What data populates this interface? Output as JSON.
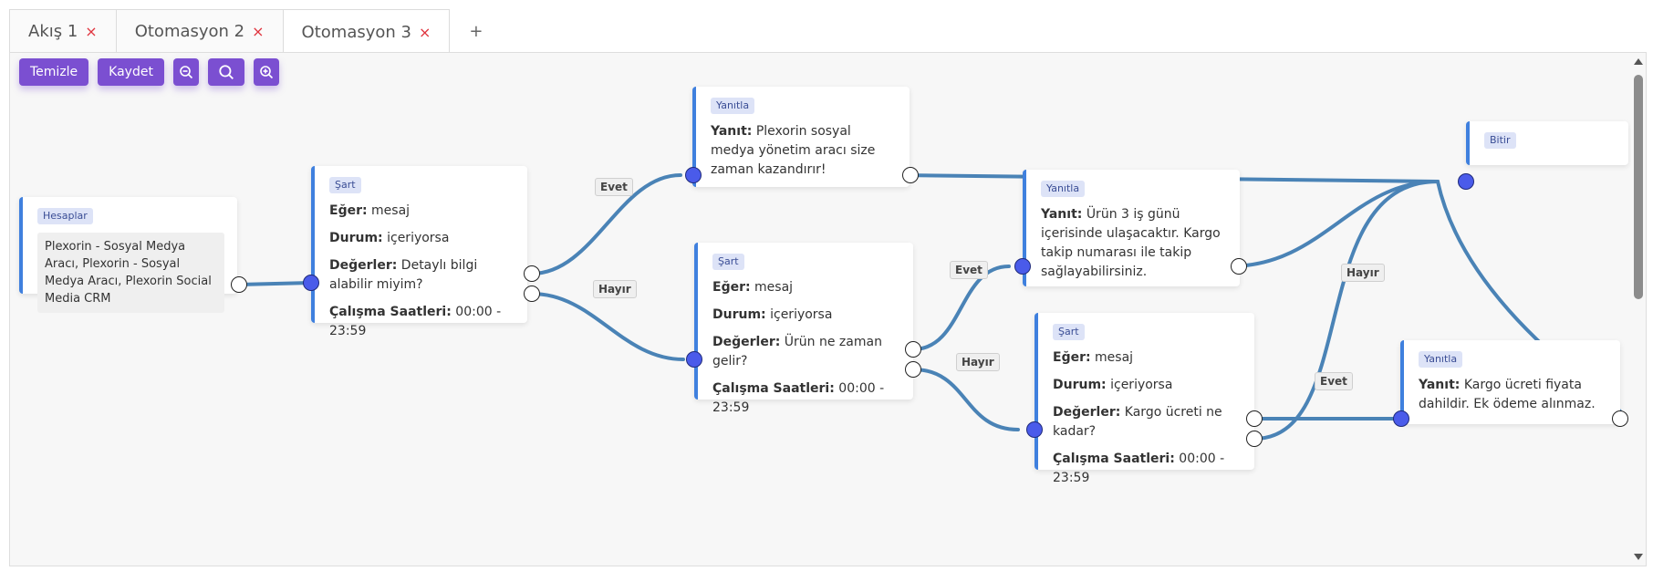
{
  "tabs": [
    {
      "label": "Akış 1",
      "close": "×"
    },
    {
      "label": "Otomasyon 2",
      "close": "×"
    },
    {
      "label": "Otomasyon 3",
      "close": "×"
    }
  ],
  "tab_add": "+",
  "toolbar": {
    "clear": "Temizle",
    "save": "Kaydet"
  },
  "nodes": {
    "accounts": {
      "title": "Hesaplar",
      "text": "Plexorin - Sosyal Medya Aracı, Plexorin - Sosyal Medya Aracı, Plexorin Social Media CRM"
    },
    "cond1": {
      "title": "Şart",
      "if_k": "Eğer:",
      "if_v": "mesaj",
      "st_k": "Durum:",
      "st_v": "içeriyorsa",
      "val_k": "Değerler:",
      "val_v": "Detaylı bilgi alabilir miyim?",
      "hrs_k": "Çalışma Saatleri:",
      "hrs_v": "00:00 - 23:59"
    },
    "reply1": {
      "title": "Yanıtla",
      "k": "Yanıt:",
      "v": "Plexorin sosyal medya yönetim aracı size zaman kazandırır!"
    },
    "cond2": {
      "title": "Şart",
      "if_k": "Eğer:",
      "if_v": "mesaj",
      "st_k": "Durum:",
      "st_v": "içeriyorsa",
      "val_k": "Değerler:",
      "val_v": "Ürün ne zaman gelir?",
      "hrs_k": "Çalışma Saatleri:",
      "hrs_v": "00:00 - 23:59"
    },
    "reply2": {
      "title": "Yanıtla",
      "k": "Yanıt:",
      "v": "Ürün 3 iş günü içerisinde ulaşacaktır. Kargo takip numarası ile takip sağlayabilirsiniz."
    },
    "cond3": {
      "title": "Şart",
      "if_k": "Eğer:",
      "if_v": "mesaj",
      "st_k": "Durum:",
      "st_v": "içeriyorsa",
      "val_k": "Değerler:",
      "val_v": "Kargo ücreti ne kadar?",
      "hrs_k": "Çalışma Saatleri:",
      "hrs_v": "00:00 - 23:59"
    },
    "reply3": {
      "title": "Yanıtla",
      "k": "Yanıt:",
      "v": "Kargo ücreti fiyata dahildir. Ek ödeme alınmaz."
    },
    "end": {
      "title": "Bitir"
    }
  },
  "edge_labels": {
    "yes": "Evet",
    "no": "Hayır"
  },
  "colors": {
    "accent": "#7b4fd1",
    "wire": "#4a83b6",
    "node_border": "#3f80de",
    "in_port": "#4a5bea",
    "close": "#e0353f"
  },
  "icons": {
    "zoom_out": "zoom-out-icon",
    "zoom_reset": "search-icon",
    "zoom_in": "zoom-in-icon"
  }
}
